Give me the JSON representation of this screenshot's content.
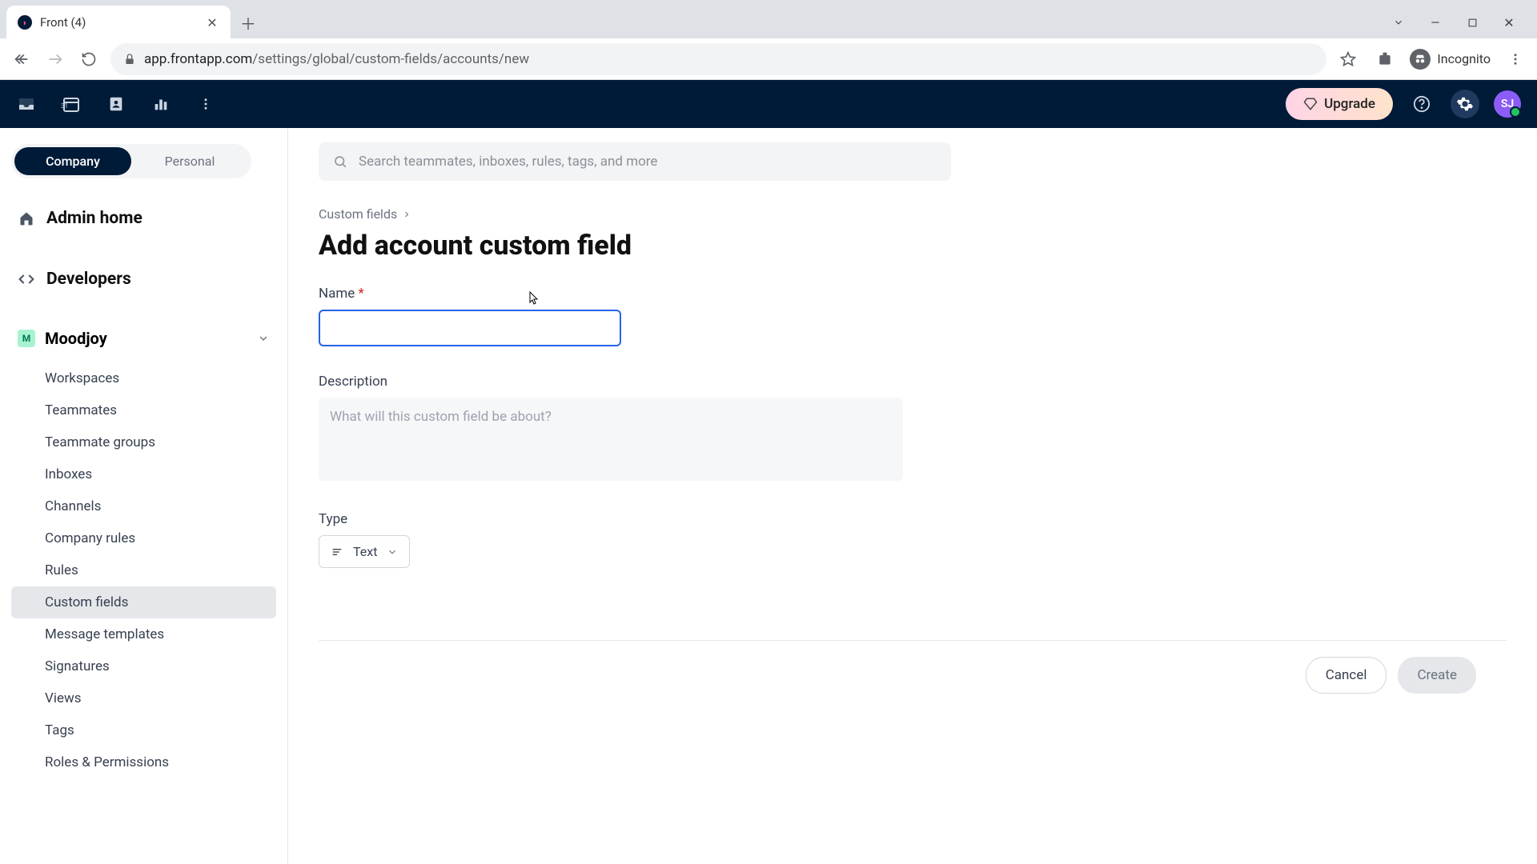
{
  "browser": {
    "tab_title": "Front (4)",
    "url_host": "app.frontapp.com",
    "url_path": "/settings/global/custom-fields/accounts/new",
    "incognito_label": "Incognito"
  },
  "header": {
    "upgrade_label": "Upgrade",
    "avatar_initials": "SJ"
  },
  "sidebar": {
    "toggle": {
      "company": "Company",
      "personal": "Personal"
    },
    "admin_home": "Admin home",
    "developers": "Developers",
    "org": {
      "initial": "M",
      "name": "Moodjoy"
    },
    "items": [
      "Workspaces",
      "Teammates",
      "Teammate groups",
      "Inboxes",
      "Channels",
      "Company rules",
      "Rules",
      "Custom fields",
      "Message templates",
      "Signatures",
      "Views",
      "Tags",
      "Roles & Permissions"
    ],
    "active_index": 7
  },
  "search": {
    "placeholder": "Search teammates, inboxes, rules, tags, and more"
  },
  "main": {
    "breadcrumb": "Custom fields",
    "title": "Add account custom field",
    "name_label": "Name",
    "required_marker": "*",
    "description_label": "Description",
    "description_placeholder": "What will this custom field be about?",
    "type_label": "Type",
    "type_value": "Text",
    "cancel": "Cancel",
    "create": "Create"
  }
}
